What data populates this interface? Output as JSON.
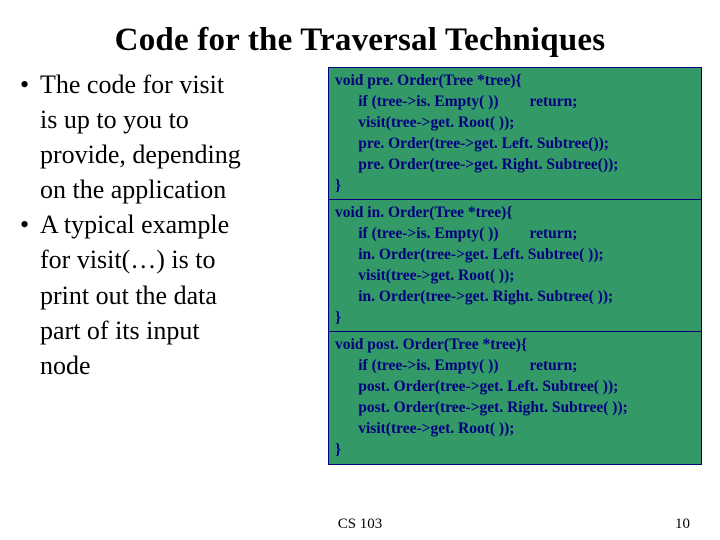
{
  "title": "Code for the Traversal Techniques",
  "bullets": {
    "b1_l1": "The code for visit",
    "b1_l2": "is up to you to",
    "b1_l3": "provide, depending",
    "b1_l4": "on the application",
    "b2_l1": "A typical example",
    "b2_l2": "for visit(…) is to",
    "b2_l3": "print out the data",
    "b2_l4": "part of its input",
    "b2_l5": "node"
  },
  "code": {
    "preorder": "void pre. Order(Tree *tree){\n      if (tree->is. Empty( ))        return;\n      visit(tree->get. Root( ));\n      pre. Order(tree->get. Left. Subtree());\n      pre. Order(tree->get. Right. Subtree());\n}",
    "inorder": "void in. Order(Tree *tree){\n      if (tree->is. Empty( ))        return;\n      in. Order(tree->get. Left. Subtree( ));\n      visit(tree->get. Root( ));\n      in. Order(tree->get. Right. Subtree( ));\n}",
    "postorder": "void post. Order(Tree *tree){\n      if (tree->is. Empty( ))        return;\n      post. Order(tree->get. Left. Subtree( ));\n      post. Order(tree->get. Right. Subtree( ));\n      visit(tree->get. Root( ));\n}"
  },
  "footer": {
    "center": "CS 103",
    "page": "10"
  },
  "symbols": {
    "bullet": "•"
  }
}
